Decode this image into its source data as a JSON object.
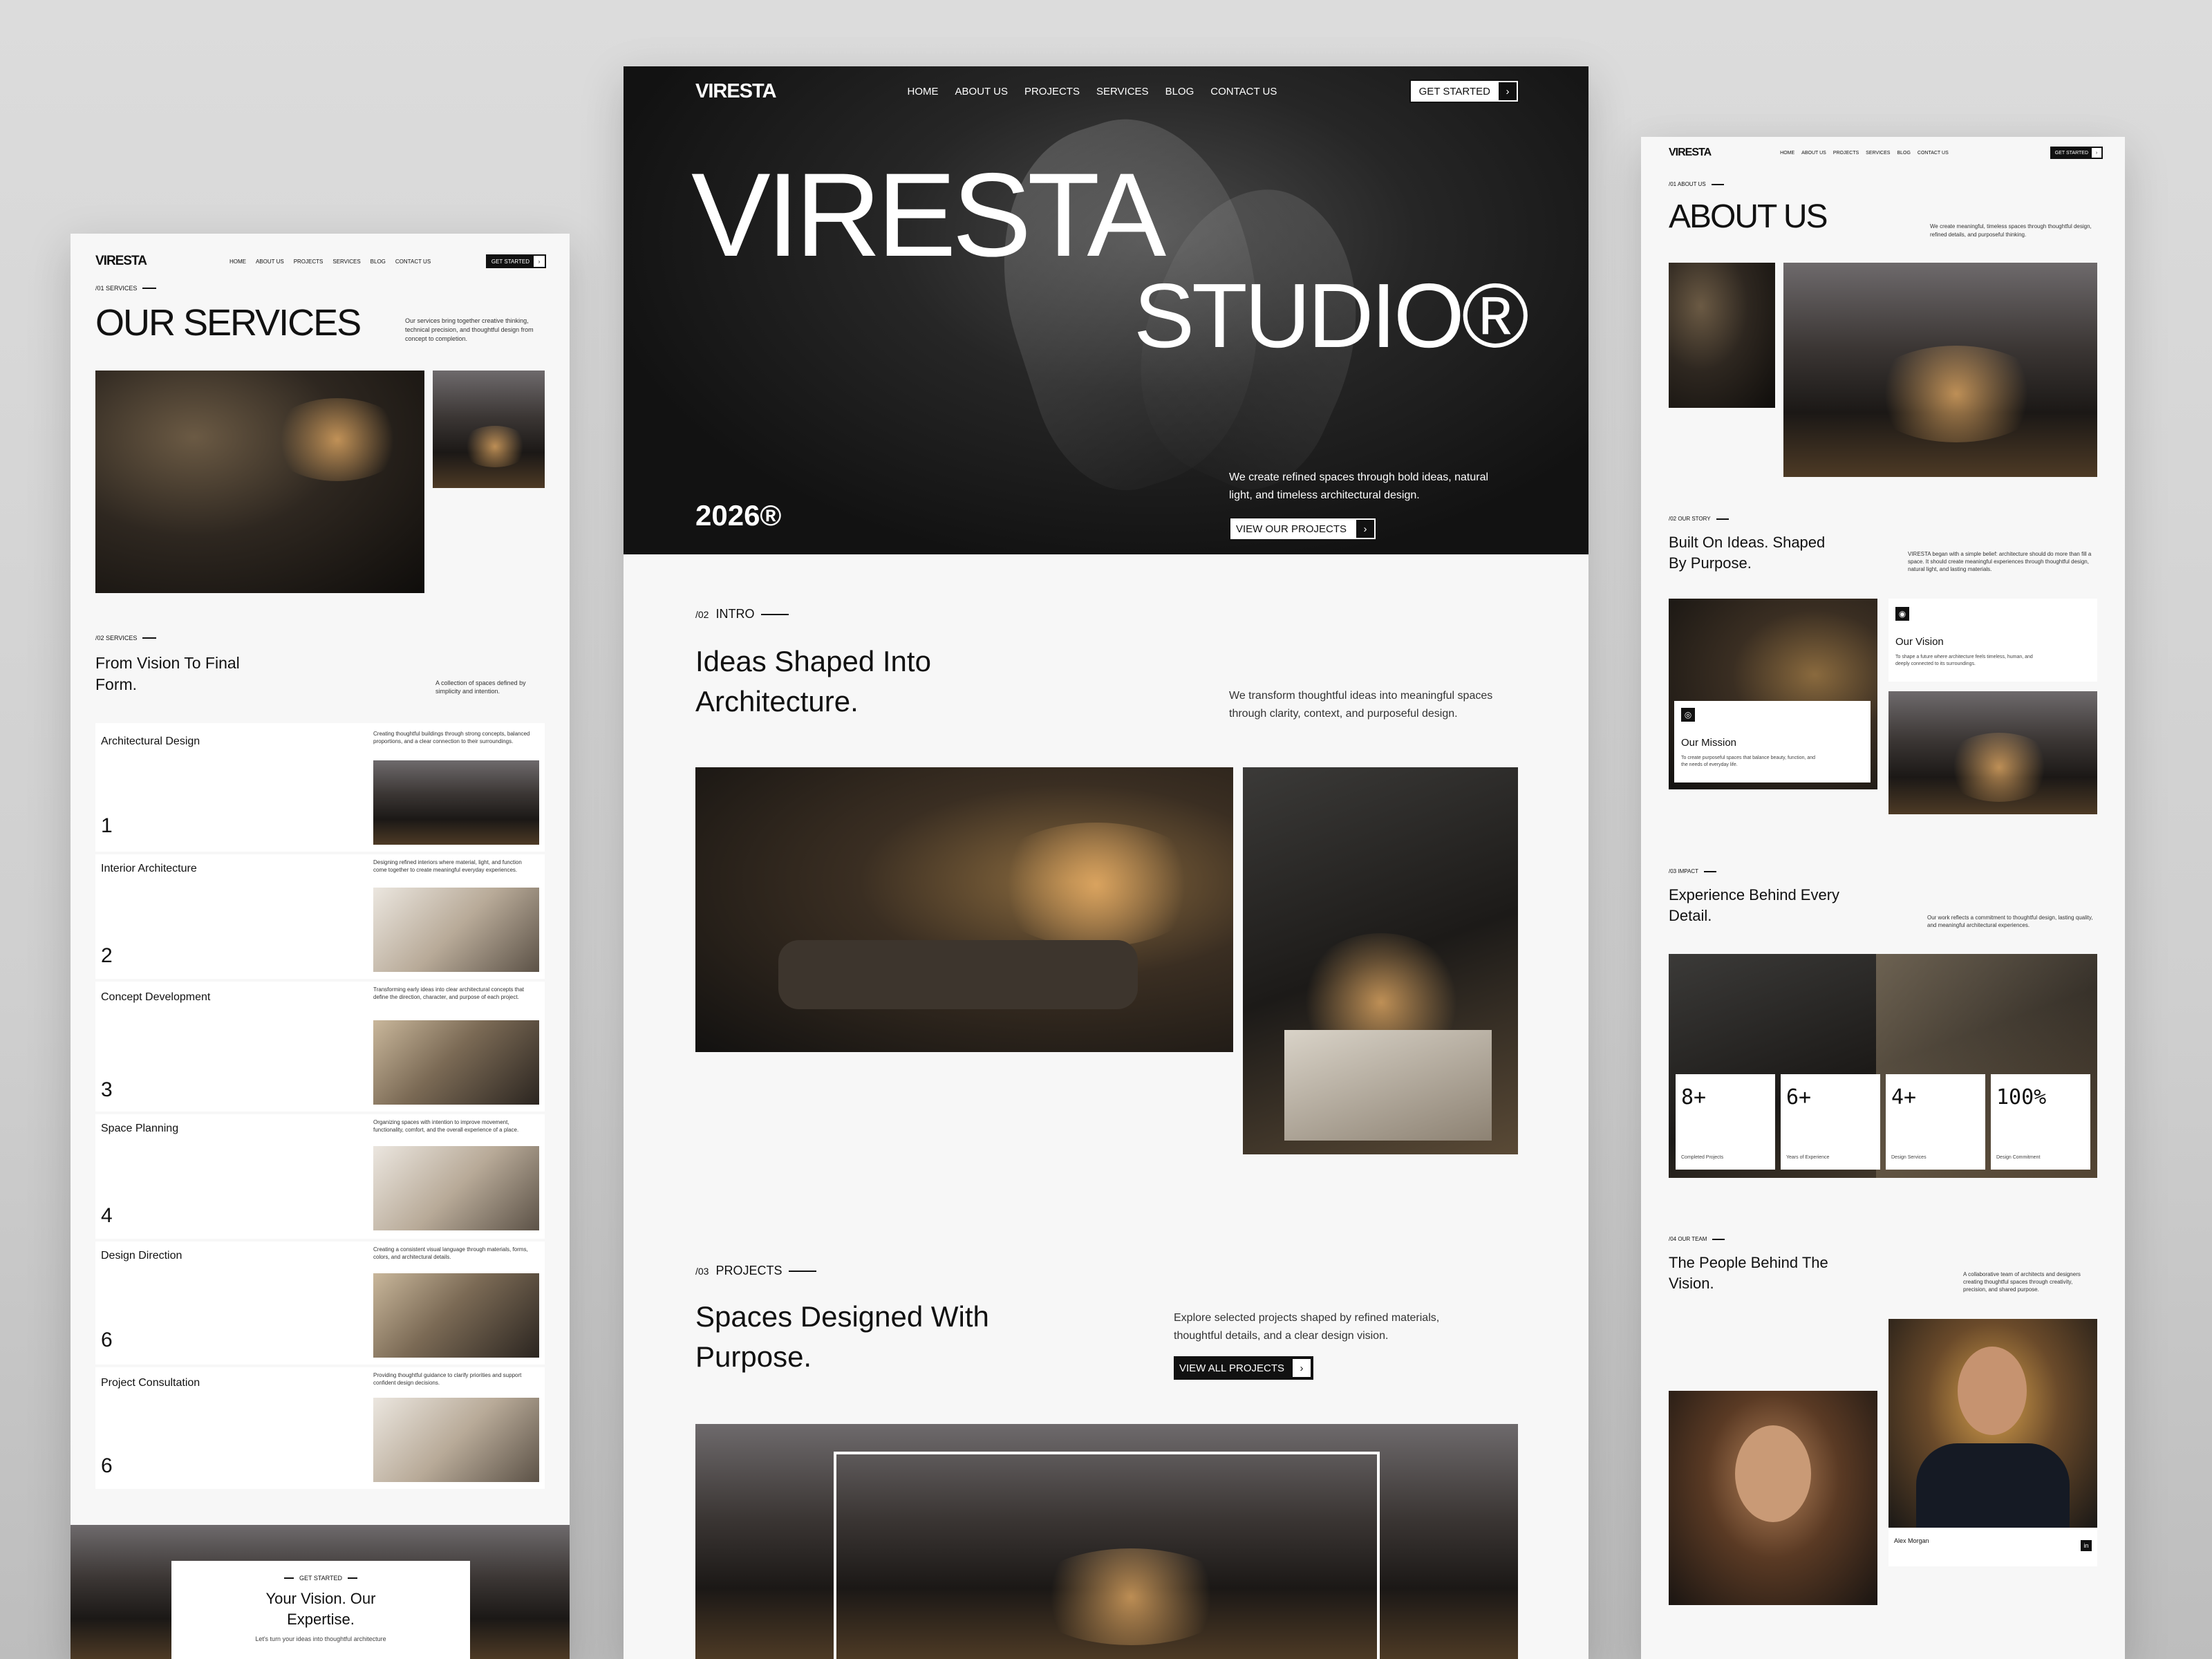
{
  "brand": "VIRESTA",
  "nav": {
    "items": [
      "HOME",
      "ABOUT US",
      "PROJECTS",
      "SERVICES",
      "BLOG",
      "CONTACT US"
    ],
    "cta": "GET STARTED"
  },
  "left": {
    "tag1": "/01 SERVICES",
    "title": "OUR SERVICES",
    "desc": "Our services bring together creative thinking, technical precision, and thoughtful design from concept to completion.",
    "tag2": "/02 SERVICES",
    "heading": "From Vision To Final Form.",
    "heading_desc": "A collection of spaces defined by simplicity and intention.",
    "services": [
      {
        "name": "Architectural Design",
        "desc": "Creating thoughtful buildings through strong concepts, balanced proportions, and a clear connection to their surroundings.",
        "num": "1"
      },
      {
        "name": "Interior Architecture",
        "desc": "Designing refined interiors where material, light, and function come together to create meaningful everyday experiences.",
        "num": "2"
      },
      {
        "name": "Concept Development",
        "desc": "Transforming early ideas into clear architectural concepts that define the direction, character, and purpose of each project.",
        "num": "3"
      },
      {
        "name": "Space Planning",
        "desc": "Organizing spaces with intention to improve movement, functionality, comfort, and the overall experience of a place.",
        "num": "4"
      },
      {
        "name": "Design Direction",
        "desc": "Creating a consistent visual language through materials, forms, colors, and architectural details.",
        "num": "6"
      },
      {
        "name": "Project Consultation",
        "desc": "Providing thoughtful guidance to clarify priorities and support confident design decisions.",
        "num": "6"
      }
    ],
    "cta_tag": "GET STARTED",
    "cta_title": "Your Vision. Our Expertise.",
    "cta_desc": "Let's turn your ideas into thoughtful architecture"
  },
  "center": {
    "hero_title_1": "VIRESTA",
    "hero_title_2": "STUDIO®",
    "year": "2026®",
    "hero_desc": "We create refined spaces through bold ideas, natural light, and timeless architectural design.",
    "hero_cta": "VIEW OUR PROJECTS",
    "intro_tag_num": "/02",
    "intro_tag": "INTRO",
    "intro_title": "Ideas Shaped Into Architecture.",
    "intro_desc": "We transform thoughtful ideas into meaningful spaces through clarity, context, and purposeful design.",
    "proj_tag_num": "/03",
    "proj_tag": "PROJECTS",
    "proj_title": "Spaces Designed With Purpose.",
    "proj_desc": "Explore selected projects shaped by refined materials, thoughtful details, and a clear design vision.",
    "proj_cta": "VIEW ALL PROJECTS"
  },
  "right": {
    "about_tag": "/01 ABOUT US",
    "about_title": "ABOUT US",
    "about_desc": "We create meaningful, timeless spaces through thoughtful design, refined details, and purposeful thinking.",
    "story_tag": "/02 OUR STORY",
    "story_title": "Built On Ideas. Shaped By Purpose.",
    "story_desc": "VIRESTA began with a simple belief: architecture should do more than fill a space. It should create meaningful experiences through thoughtful design, natural light, and lasting materials.",
    "vision_title": "Our Vision",
    "vision_desc": "To shape a future where architecture feels timeless, human, and deeply connected to its surroundings.",
    "mission_title": "Our Mission",
    "mission_desc": "To create purposeful spaces that balance beauty, function, and the needs of everyday life.",
    "impact_tag": "/03 IMPACT",
    "impact_title": "Experience Behind Every Detail.",
    "impact_desc": "Our work reflects a commitment to thoughtful design, lasting quality, and meaningful architectural experiences.",
    "stats": [
      {
        "value": "8+",
        "label": "Completed Projects"
      },
      {
        "value": "6+",
        "label": "Years of Experience"
      },
      {
        "value": "4+",
        "label": "Design Services"
      },
      {
        "value": "100%",
        "label": "Design Commitment"
      }
    ],
    "team_tag": "/04 OUR TEAM",
    "team_title": "The People Behind The Vision.",
    "team_desc": "A collaborative team of architects and designers creating thoughtful spaces through creativity, precision, and shared purpose.",
    "member": "Alex Morgan"
  }
}
